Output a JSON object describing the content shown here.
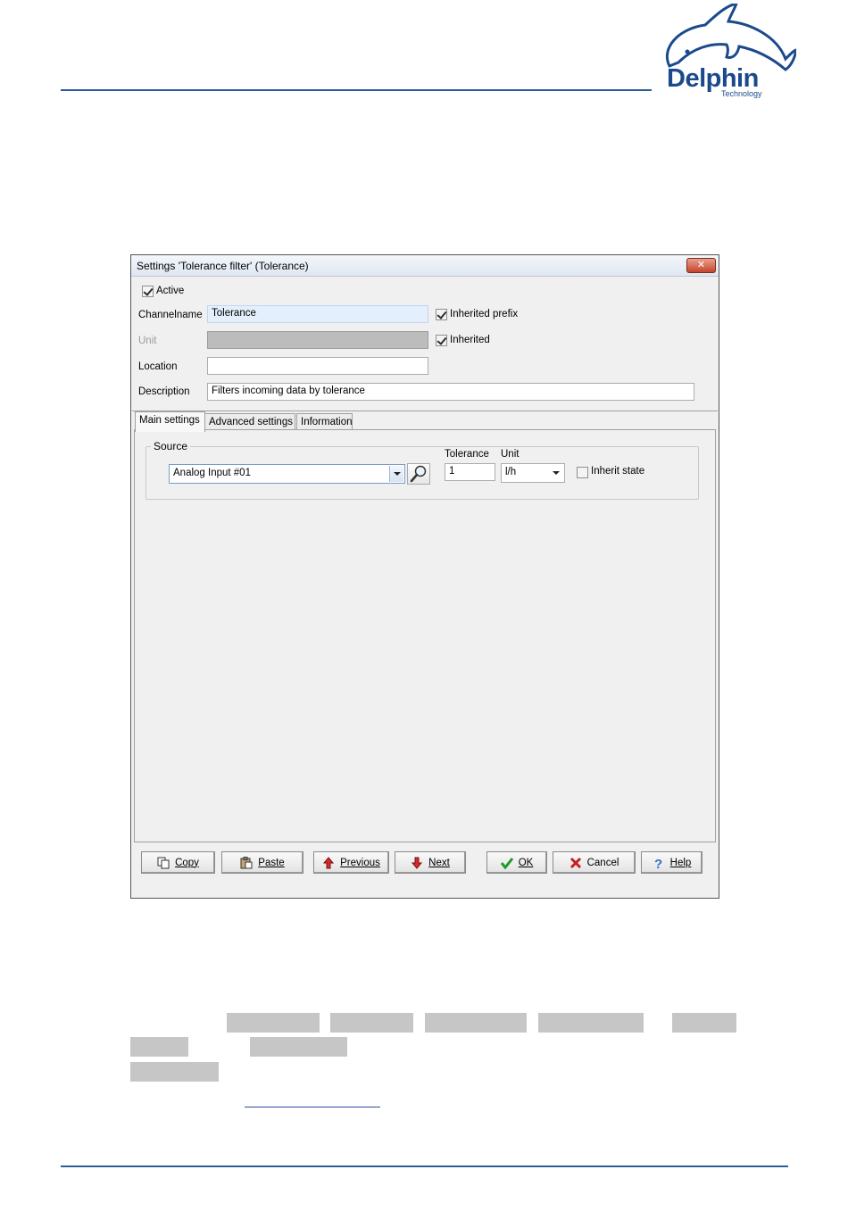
{
  "brand": {
    "logo_name": "Delphin",
    "logo_sub": "Technology"
  },
  "dialog": {
    "title": "Settings 'Tolerance filter' (Tolerance)",
    "close_glyph": "✕",
    "active_label": "Active",
    "active_checked": true,
    "channelname_label": "Channelname",
    "channelname_value": "Tolerance",
    "inherited_prefix_label": "Inherited prefix",
    "inherited_prefix_checked": true,
    "unit_label": "Unit",
    "unit_value": "",
    "inherited_label": "Inherited",
    "inherited_checked": true,
    "location_label": "Location",
    "location_value": "",
    "description_label": "Description",
    "description_value": "Filters incoming data by tolerance"
  },
  "tabs": [
    {
      "label": "Main settings",
      "active": true
    },
    {
      "label": "Advanced settings",
      "active": false
    },
    {
      "label": "Information",
      "active": false
    }
  ],
  "main_settings": {
    "source_legend": "Source",
    "source_value": "Analog Input #01",
    "tolerance_label": "Tolerance",
    "tolerance_value": "1",
    "unit_label": "Unit",
    "unit_value": "l/h",
    "inherit_state_label": "Inherit state",
    "inherit_state_checked": false
  },
  "buttons": {
    "copy": "Copy",
    "paste": "Paste",
    "previous": "Previous",
    "next": "Next",
    "ok": "OK",
    "cancel": "Cancel",
    "help": "Help"
  },
  "icons": [
    "copy-icon",
    "paste-icon",
    "arrow-up-icon",
    "arrow-down-icon",
    "checkmark-icon",
    "x-icon",
    "help-icon",
    "magnifier-icon",
    "dolphin-logo"
  ],
  "colors": {
    "brand_blue": "#1b4a8c",
    "rule_blue": "#2a5d9c"
  }
}
